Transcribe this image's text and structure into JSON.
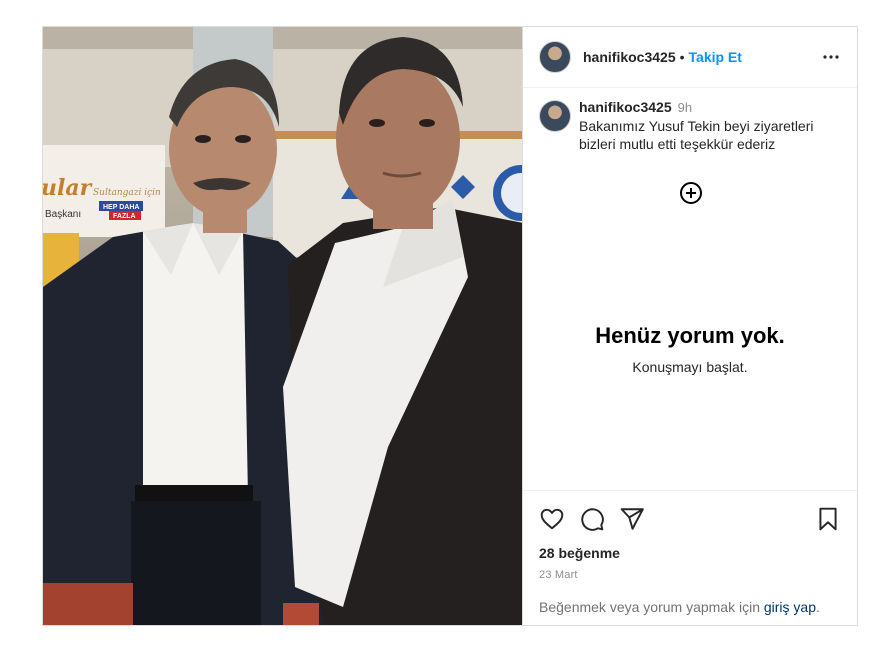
{
  "post": {
    "username": "hanifikoc3425",
    "follow_label": "Takip Et",
    "separator": "•",
    "caption_user": "hanifikoc3425",
    "caption_time": "9h",
    "caption_text": "Bakanımız Yusuf Tekin beyi ziyaretleri bizleri mutlu etti teşekkür ederiz",
    "empty_title": "Henüz yorum yok.",
    "empty_subtitle": "Konuşmayı başlat.",
    "likes": "28 beğenme",
    "date": "23 Mart",
    "login_prefix": "Beğenmek veya yorum yapmak için ",
    "login_link": "giriş yap",
    "login_suffix": "."
  },
  "photo_text": {
    "brand_fragment": "ular",
    "brand_sub": "Başkanı",
    "slogan": "Sultangazi için",
    "slogan_bold": "HEP DAHA",
    "slogan_bold2": "FAZLA"
  },
  "icons": {
    "more": "more-options-icon",
    "add_comment": "add-circle-icon",
    "like": "heart-icon",
    "comment": "comment-icon",
    "share": "share-icon",
    "save": "bookmark-icon"
  },
  "colors": {
    "accent": "#0095f6",
    "link": "#00376b",
    "muted": "#8e8e8e"
  }
}
